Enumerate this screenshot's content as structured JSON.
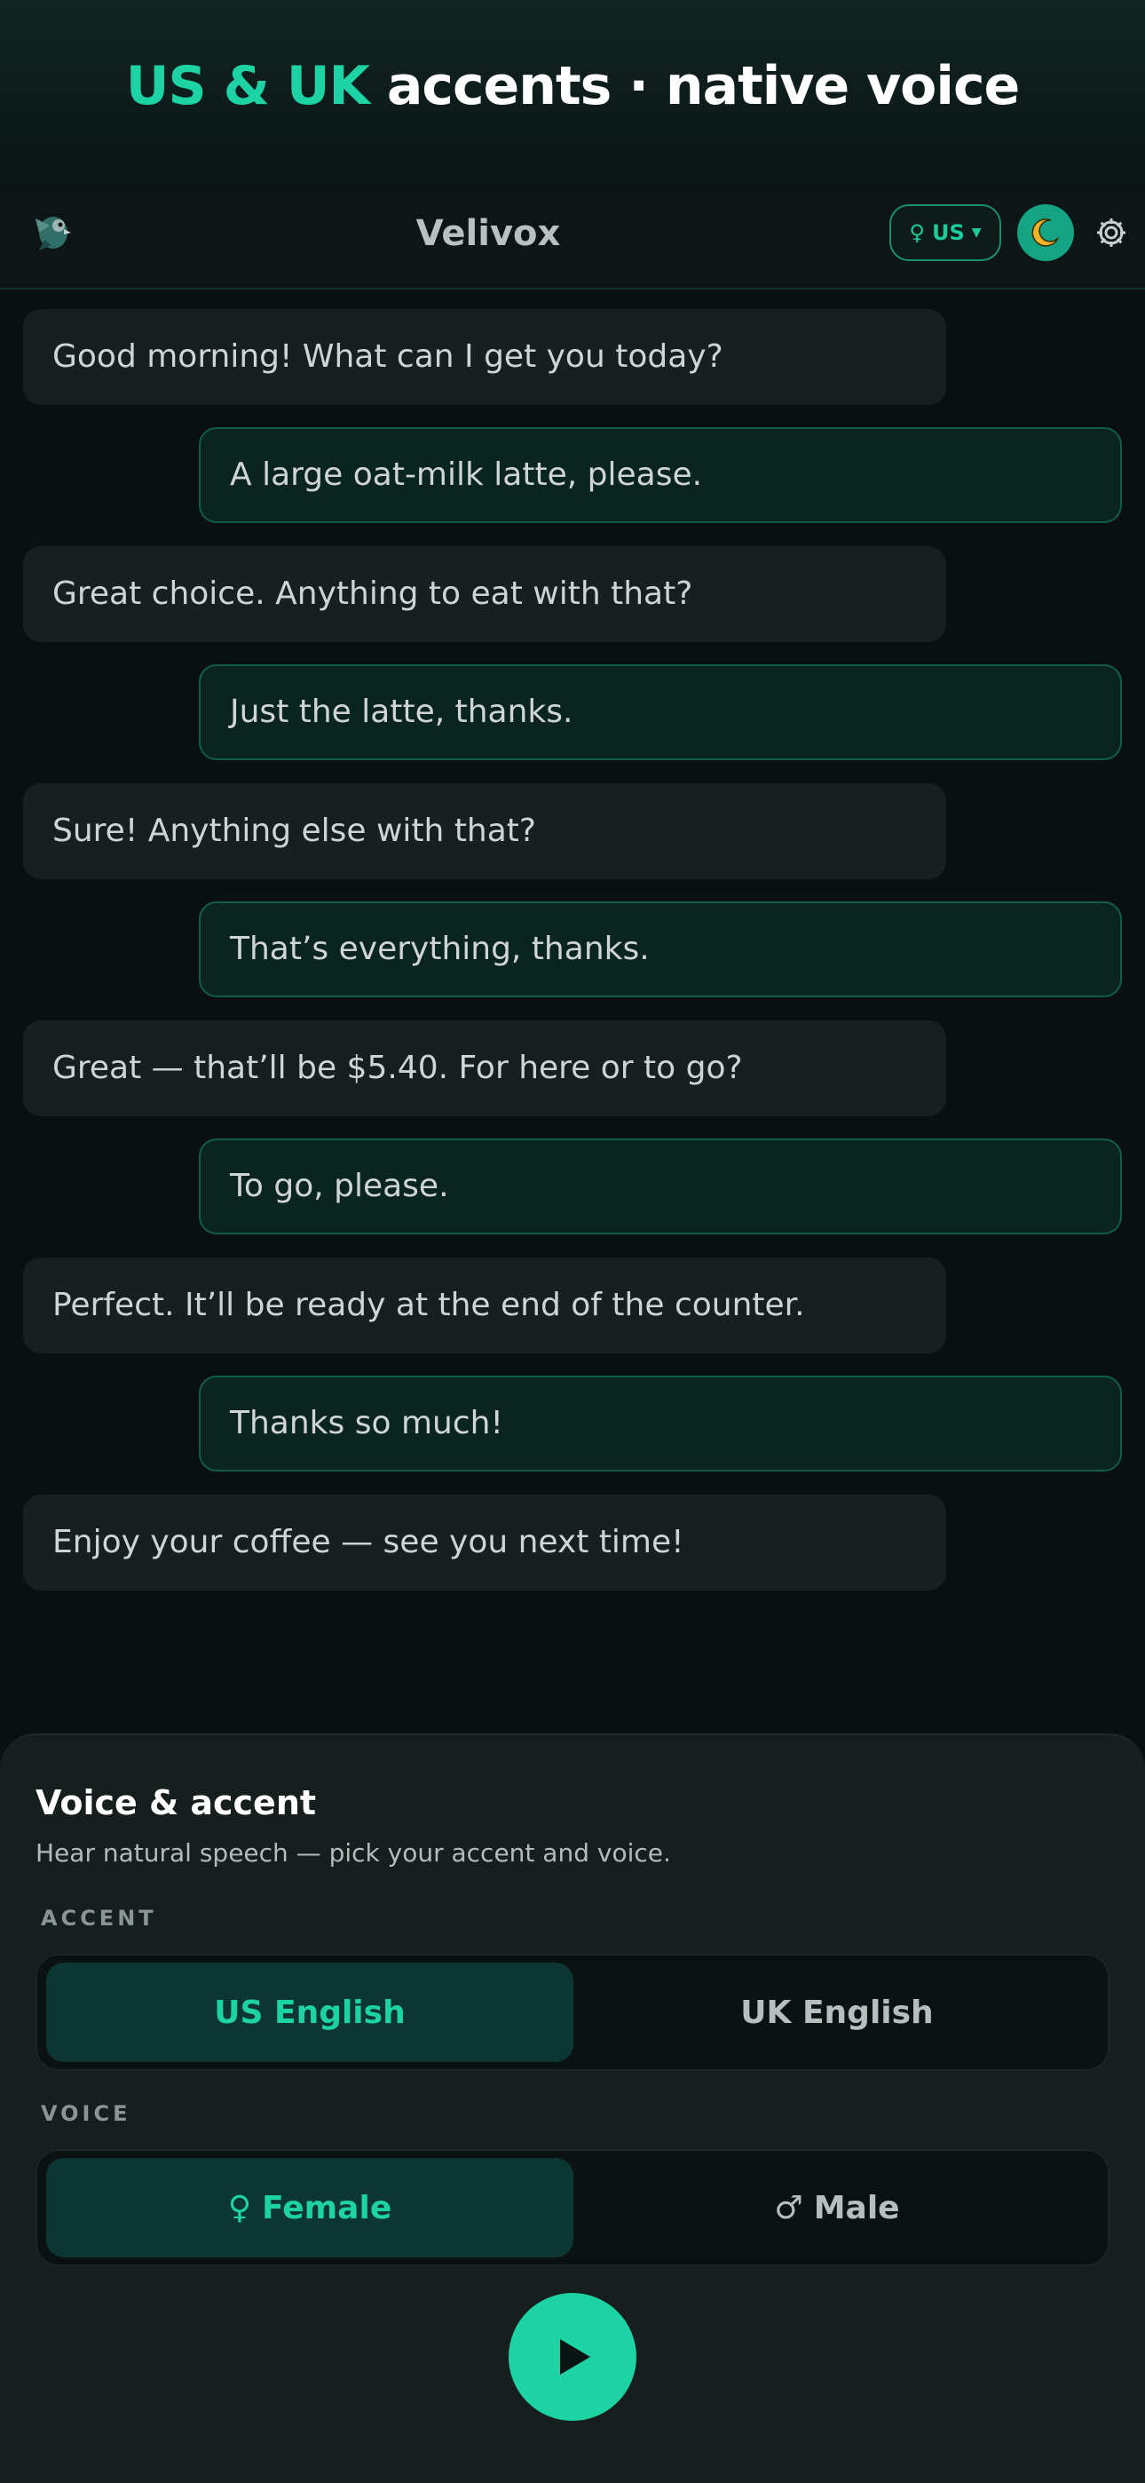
{
  "hero": {
    "title_accent": "US & UK",
    "title_rest": " accents · native voice"
  },
  "appbar": {
    "title": "Velivox",
    "locale_symbol": "♀",
    "locale_label": "US",
    "locale_caret": "▼"
  },
  "chat": {
    "messages": [
      {
        "role": "bot",
        "text": "Good morning! What can I get you today?"
      },
      {
        "role": "user",
        "text": "A large oat-milk latte, please."
      },
      {
        "role": "bot",
        "text": "Great choice. Anything to eat with that?"
      },
      {
        "role": "user",
        "text": "Just the latte, thanks."
      },
      {
        "role": "bot",
        "text": "Sure! Anything else with that?"
      },
      {
        "role": "user",
        "text": "That’s everything, thanks."
      },
      {
        "role": "bot",
        "text": "Great — that’ll be $5.40. For here or to go?"
      },
      {
        "role": "user",
        "text": "To go, please."
      },
      {
        "role": "bot",
        "text": "Perfect. It’ll be ready at the end of the counter."
      },
      {
        "role": "user",
        "text": "Thanks so much!"
      },
      {
        "role": "bot",
        "text": "Enjoy your coffee — see you next time!"
      }
    ]
  },
  "sheet": {
    "title": "Voice & accent",
    "subtitle": "Hear natural speech — pick your accent and voice.",
    "accent_label": "ACCENT",
    "accent_options": [
      "US English",
      "UK English"
    ],
    "accent_selected": "US English",
    "voice_label": "VOICE",
    "voice_options": [
      {
        "symbol": "♀",
        "label": "Female"
      },
      {
        "symbol": "♂",
        "label": "Male"
      }
    ],
    "voice_selected": "Female"
  },
  "colors": {
    "accent": "#1ed3a3",
    "background": "#0a0f10",
    "bot_bubble": "#181f20",
    "user_bubble": "#0a2520"
  },
  "icons": {
    "logo": "parrot-logo-icon",
    "theme": "moon-icon",
    "settings": "gear-icon",
    "play": "play-icon"
  }
}
